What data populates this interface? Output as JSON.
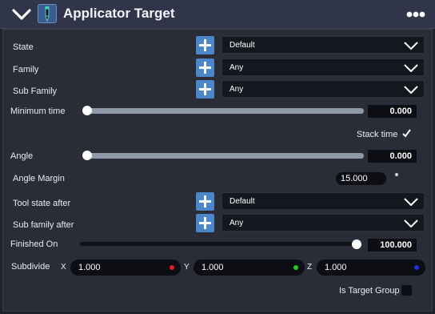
{
  "header": {
    "title": "Applicator Target",
    "icons": {
      "collapse": "chevron-down-icon",
      "component": "applicator-component-icon",
      "more": "more-options-icon"
    }
  },
  "fields": {
    "state": {
      "label": "State",
      "value": "Default"
    },
    "family": {
      "label": "Family",
      "value": "Any"
    },
    "sub_family": {
      "label": "Sub Family",
      "value": "Any"
    },
    "minimum_time": {
      "label": "Minimum time",
      "value": "0.000",
      "slider_fraction": 0.0
    },
    "stack_time": {
      "label": "Stack time",
      "checked": true
    },
    "angle": {
      "label": "Angle",
      "value": "0.000",
      "slider_fraction": 0.0
    },
    "angle_margin": {
      "label": "Angle Margin",
      "value": "15.000"
    },
    "tool_state_after": {
      "label": "Tool state after",
      "value": "Default"
    },
    "sub_family_after": {
      "label": "Sub family after",
      "value": "Any"
    },
    "finished_on": {
      "label": "Finished On",
      "value": "100.000",
      "slider_fraction": 1.0
    },
    "subdivide": {
      "label": "Subdivide",
      "x": {
        "axis": "X",
        "value": "1.000",
        "color": "#e02020"
      },
      "y": {
        "axis": "Y",
        "value": "1.000",
        "color": "#22cc22"
      },
      "z": {
        "axis": "Z",
        "value": "1.000",
        "color": "#2233dd"
      }
    },
    "is_target_group": {
      "label": "Is Target Group",
      "checked": false
    }
  },
  "colors": {
    "accent": "#4a86c8",
    "header_bg": "#30354a",
    "panel_bg": "#2a2d38",
    "field_bg": "#14171e"
  }
}
